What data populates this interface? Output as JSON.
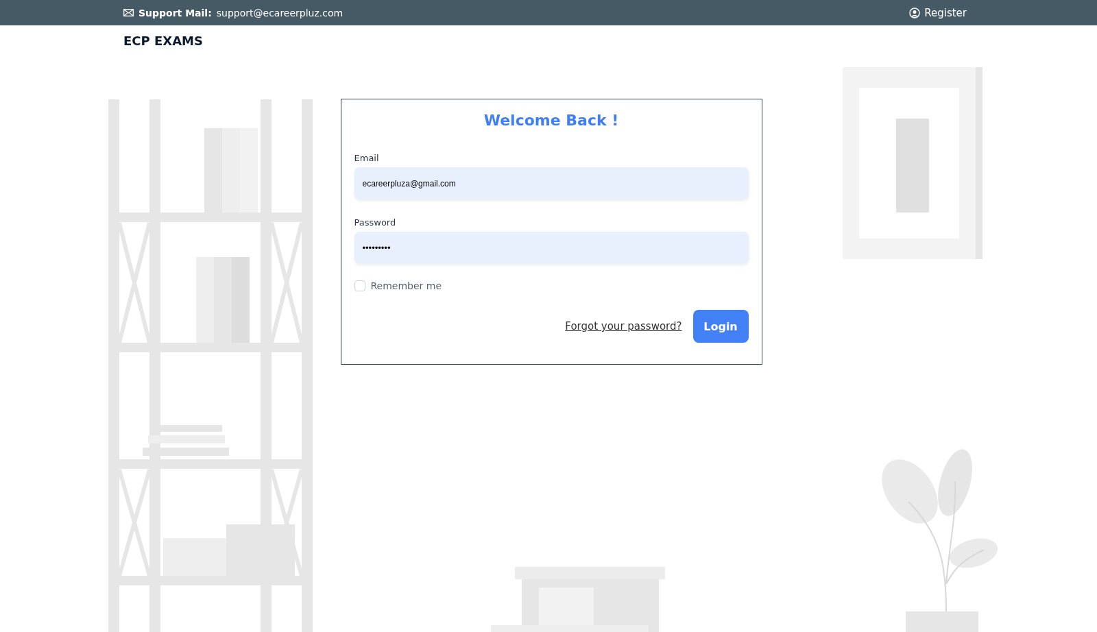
{
  "top_bar": {
    "support_label": "Support Mail:",
    "support_email": "support@ecareerpluz.com",
    "register": "Register"
  },
  "brand": "ECP EXAMS",
  "login_form": {
    "title": "Welcome Back !",
    "fields": [
      {
        "label": "Email",
        "value": "ecareerpluza@gmail.com",
        "kind": "text"
      },
      {
        "label": "Password",
        "value": "•••••••••",
        "kind": "password"
      }
    ],
    "remember": {
      "label": "Remember me",
      "checked": false
    },
    "forgot_link": "Forgot your password?",
    "submit": "Login"
  }
}
